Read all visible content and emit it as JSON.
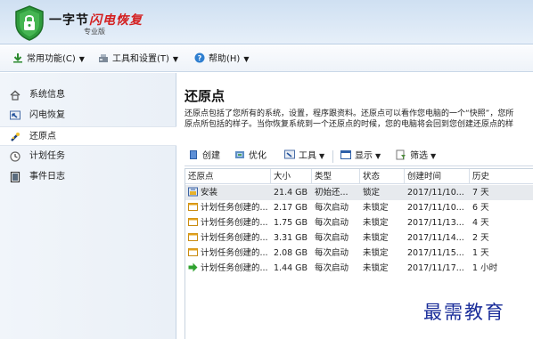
{
  "header": {
    "title_part1": "一字节",
    "title_part2": "闪电恢复",
    "subtitle": "专业版"
  },
  "menu": [
    {
      "label": "常用功能(C)",
      "icon": "download-icon"
    },
    {
      "label": "工具和设置(T)",
      "icon": "tools-icon"
    },
    {
      "label": "帮助(H)",
      "icon": "help-icon"
    }
  ],
  "sidebar": {
    "items": [
      {
        "label": "系统信息",
        "icon": "home-icon"
      },
      {
        "label": "闪电恢复",
        "icon": "restore-icon"
      },
      {
        "label": "还原点",
        "icon": "wand-icon",
        "active": true
      },
      {
        "label": "计划任务",
        "icon": "clock-icon"
      },
      {
        "label": "事件日志",
        "icon": "log-icon"
      }
    ]
  },
  "main": {
    "title": "还原点",
    "description_line1": "还原点包括了您所有的系统，设置，程序跟资料。还原点可以看作您电脑的一个“快照”，您所",
    "description_line2": "原点所包括的样子。当你恢复系统到一个还原点的时候，您的电脑将会回到您创建还原点的样"
  },
  "toolbar": {
    "create": "创建",
    "optimize": "优化",
    "tools": "工具",
    "view": "显示",
    "filter": "筛选"
  },
  "table": {
    "columns": [
      "还原点",
      "大小",
      "类型",
      "状态",
      "创建时间",
      "历史"
    ],
    "rows": [
      {
        "name": "安装",
        "size": "21.4 GB",
        "type": "初始还...",
        "status": "锁定",
        "created": "2017/11/10...",
        "history": "7 天",
        "icon": "install-icon",
        "selected": true
      },
      {
        "name": "计划任务创建的...",
        "size": "2.17 GB",
        "type": "每次启动",
        "status": "未锁定",
        "created": "2017/11/10...",
        "history": "6 天",
        "icon": "folder-icon"
      },
      {
        "name": "计划任务创建的...",
        "size": "1.75 GB",
        "type": "每次启动",
        "status": "未锁定",
        "created": "2017/11/13...",
        "history": "4 天",
        "icon": "folder-icon"
      },
      {
        "name": "计划任务创建的...",
        "size": "3.31 GB",
        "type": "每次启动",
        "status": "未锁定",
        "created": "2017/11/14...",
        "history": "2 天",
        "icon": "folder-icon"
      },
      {
        "name": "计划任务创建的...",
        "size": "2.08 GB",
        "type": "每次启动",
        "status": "未锁定",
        "created": "2017/11/15...",
        "history": "1 天",
        "icon": "folder-icon"
      },
      {
        "name": "计划任务创建的...",
        "size": "1.44 GB",
        "type": "每次启动",
        "status": "未锁定",
        "created": "2017/11/17...",
        "history": "1 小时",
        "icon": "arrow-right-icon"
      }
    ]
  },
  "watermark": "最需教育",
  "colors": {
    "brand_red": "#d41f1f",
    "shield_green": "#2e9b3c",
    "watermark_blue": "#1b2e9a"
  }
}
